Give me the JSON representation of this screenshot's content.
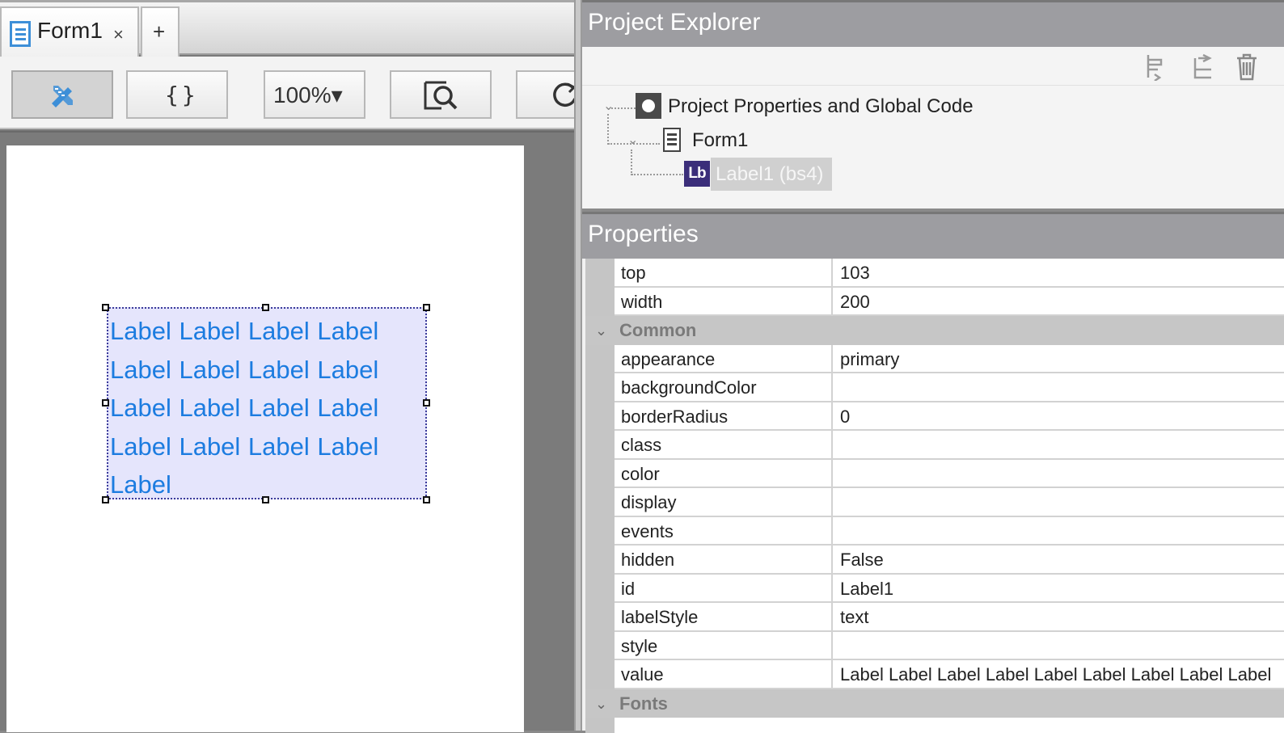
{
  "editor": {
    "tab_title": "Form1",
    "tab_close": "×",
    "tab_add": "+",
    "toolbar": {
      "code_label": "{}",
      "zoom_label": "100%▾"
    },
    "label1_text": "Label Label Label Label Label Label Label Label Label Label Label Label Label Label Label Label Label"
  },
  "explorer": {
    "title": "Project Explorer",
    "tree": {
      "root": "Project Properties and Global Code",
      "form": "Form1",
      "label_icon": "Lb",
      "label_item": "Label1 (bs4)"
    }
  },
  "properties": {
    "title": "Properties",
    "rows_top": [
      {
        "name": "top",
        "value": "103"
      },
      {
        "name": "width",
        "value": "200"
      }
    ],
    "group_common": "Common",
    "rows_common": [
      {
        "name": "appearance",
        "value": "primary"
      },
      {
        "name": "backgroundColor",
        "value": ""
      },
      {
        "name": "borderRadius",
        "value": "0"
      },
      {
        "name": "class",
        "value": ""
      },
      {
        "name": "color",
        "value": ""
      },
      {
        "name": "display",
        "value": ""
      },
      {
        "name": "events",
        "value": ""
      },
      {
        "name": "hidden",
        "value": "False"
      },
      {
        "name": "id",
        "value": "Label1"
      },
      {
        "name": "labelStyle",
        "value": "text"
      },
      {
        "name": "style",
        "value": ""
      },
      {
        "name": "value",
        "value": "Label Label Label Label Label Label Label Label Label"
      }
    ],
    "group_fonts": "Fonts"
  },
  "colors": {
    "accent": "#1c7ce0",
    "header": "#9d9da1",
    "selection": "#e5e5fc"
  }
}
